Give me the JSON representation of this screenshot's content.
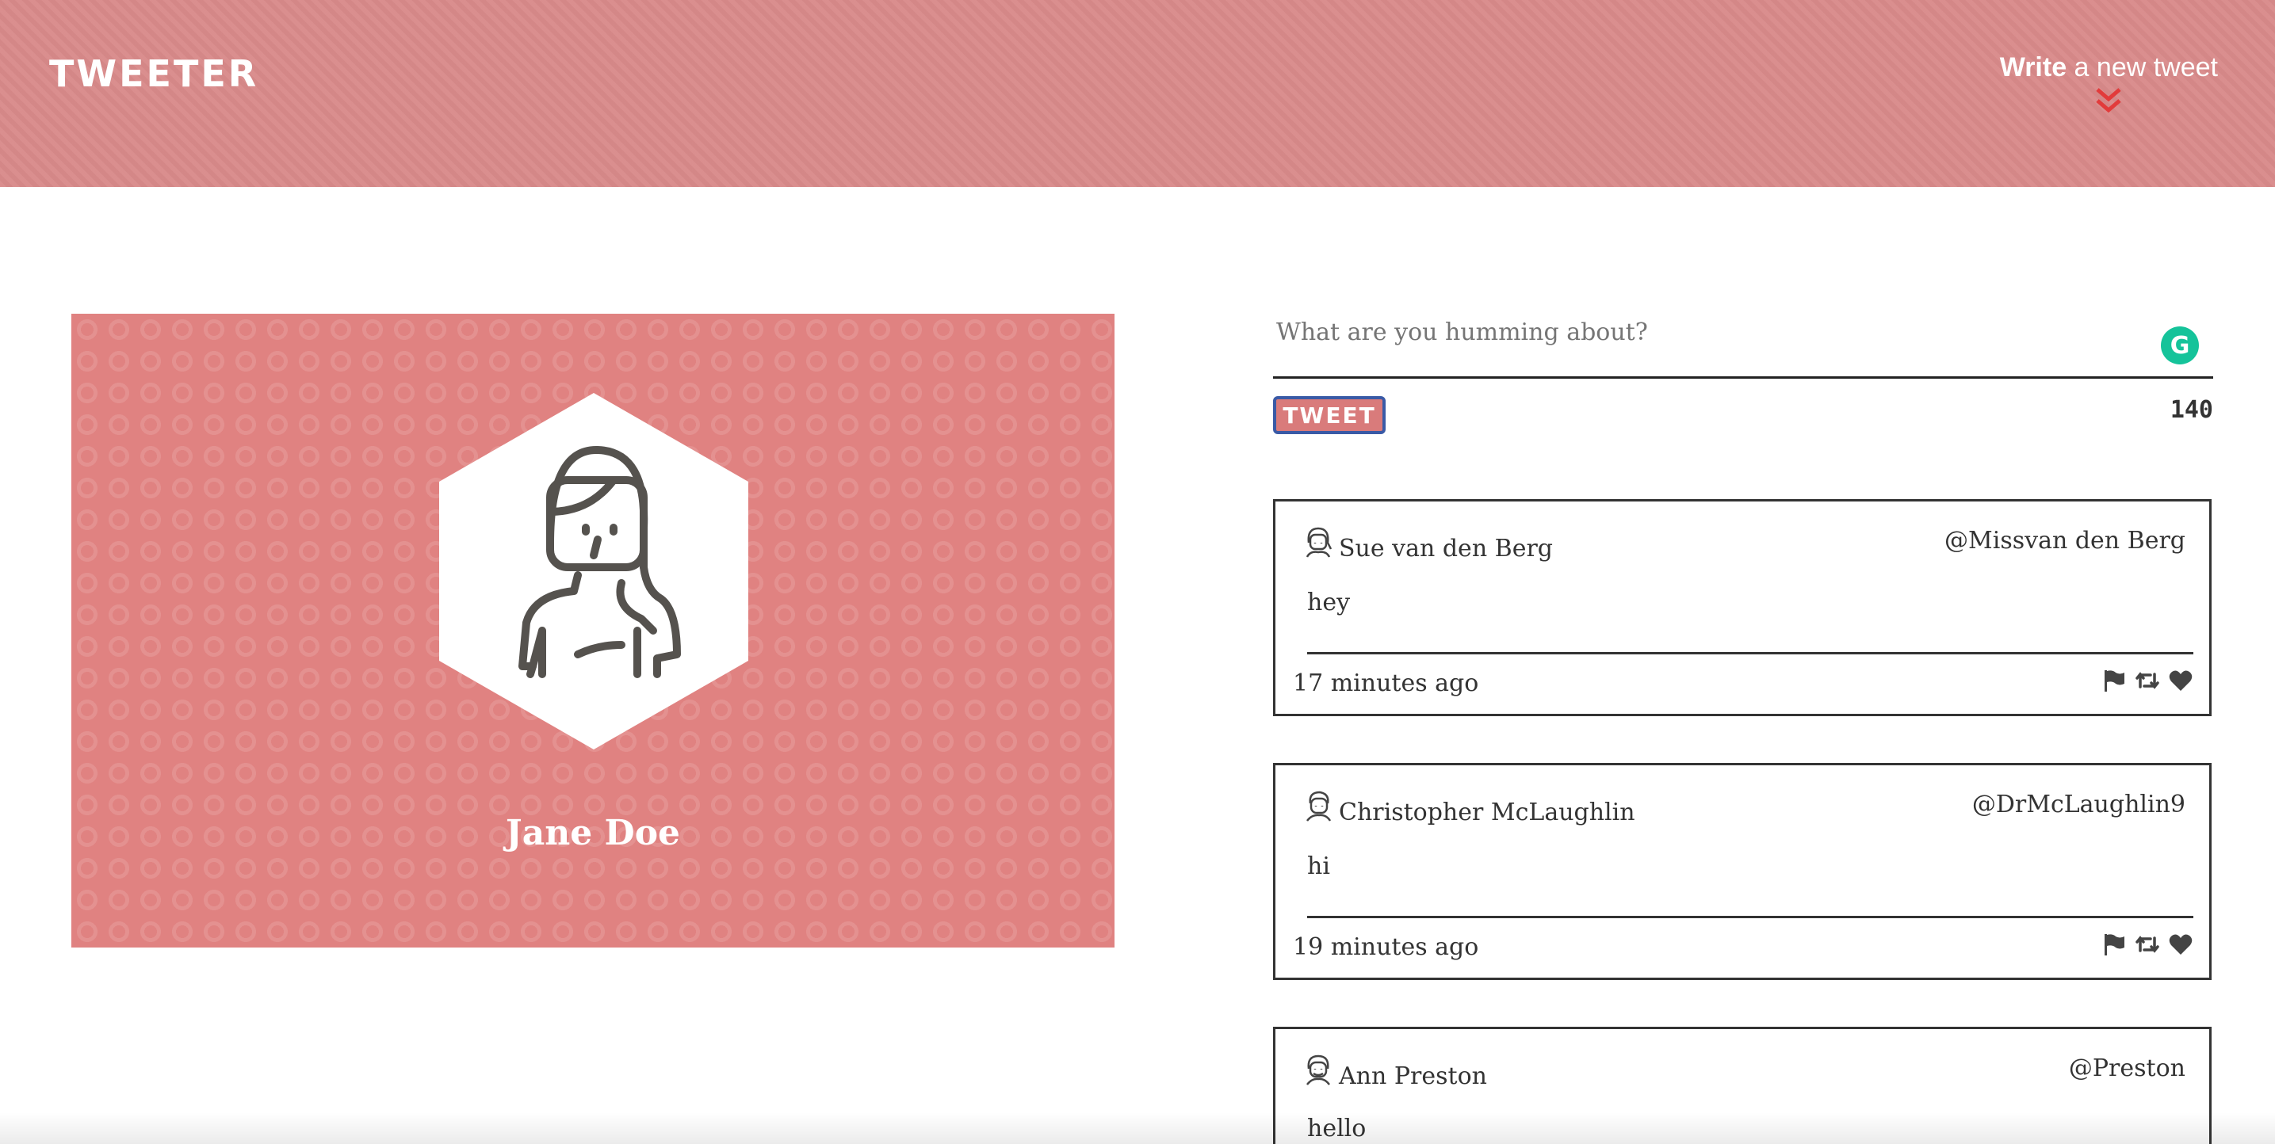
{
  "nav": {
    "brand": "TWEETER",
    "compose_strong": "Write",
    "compose_rest": " a new tweet",
    "compose_icon": "double-chevron-down-icon"
  },
  "profile": {
    "name": "Jane Doe",
    "avatar_icon": "female-user-avatar-icon"
  },
  "composer": {
    "placeholder": "What are you humming about?",
    "button_label": "TWEET",
    "counter": "140",
    "grammarly_glyph": "G"
  },
  "tweets": [
    {
      "name": "Sue van den Berg",
      "handle": "@Missvan den Berg",
      "text": "hey",
      "time": "17 minutes ago"
    },
    {
      "name": "Christopher McLaughlin",
      "handle": "@DrMcLaughlin9",
      "text": "hi",
      "time": "19 minutes ago"
    },
    {
      "name": "Ann Preston",
      "handle": "@Preston",
      "text": "hello",
      "time": ""
    }
  ],
  "colors": {
    "nav_bg": "#d88a8a",
    "profile_bg": "#e08281",
    "chevron": "#e23b3b",
    "button_border": "#3a5aa6",
    "grammarly": "#15c39a"
  }
}
